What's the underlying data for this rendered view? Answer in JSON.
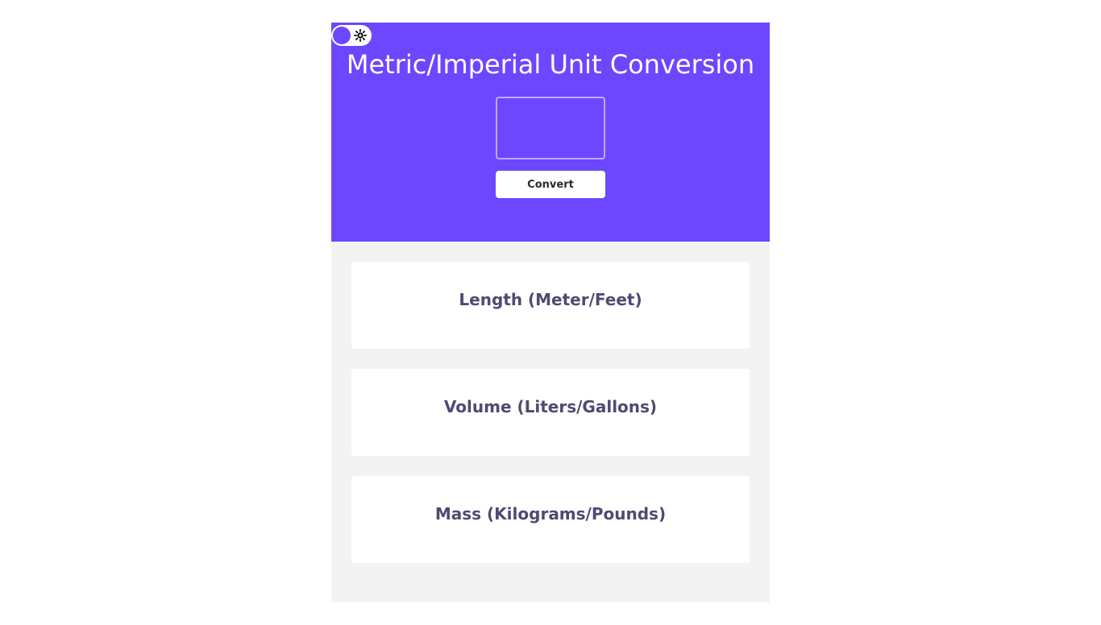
{
  "header": {
    "title": "Metric/Imperial Unit Conversion",
    "input_value": "",
    "convert_label": "Convert"
  },
  "theme_toggle": {
    "icon": "sun-icon",
    "knob_color": "#6c47ff"
  },
  "colors": {
    "accent": "#6c47ff",
    "panel_background": "#f3f3f3",
    "card_background": "#ffffff",
    "card_text": "#4f4a72"
  },
  "cards": [
    {
      "title": "Length (Meter/Feet)",
      "result": ""
    },
    {
      "title": "Volume (Liters/Gallons)",
      "result": ""
    },
    {
      "title": "Mass (Kilograms/Pounds)",
      "result": ""
    }
  ]
}
